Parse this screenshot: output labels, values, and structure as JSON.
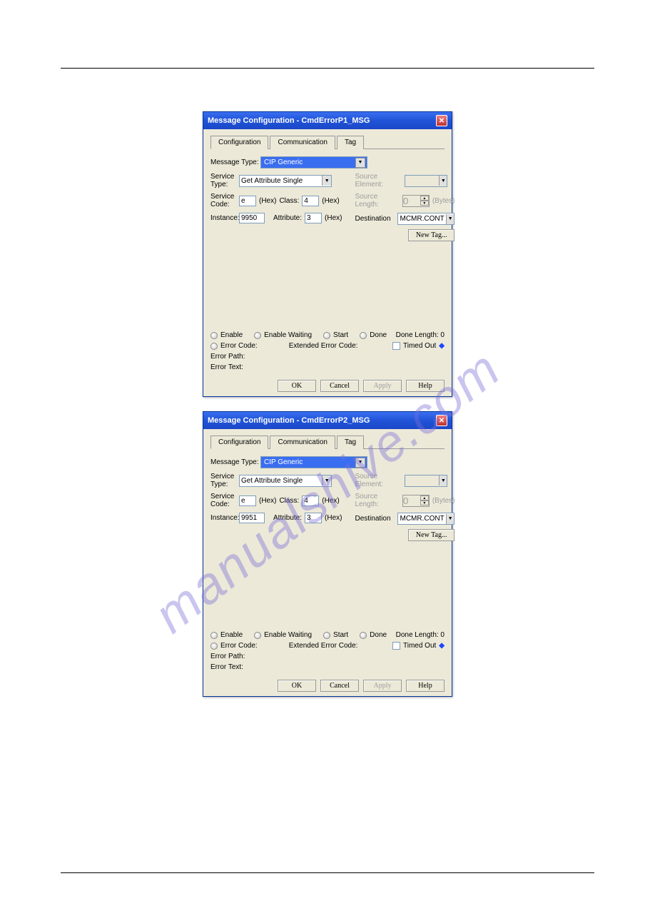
{
  "watermark": "manualshive.com",
  "dialogs": [
    {
      "title": "Message Configuration - CmdErrorP1_MSG",
      "tabs": [
        "Configuration",
        "Communication",
        "Tag"
      ],
      "active_tab": 0,
      "message_type_label": "Message Type:",
      "message_type": "CIP Generic",
      "service_type_label": "Service\nType:",
      "service_type": "Get Attribute Single",
      "service_code_label": "Service\nCode:",
      "service_code": "e",
      "instance_label": "Instance:",
      "instance": "9950",
      "class_label": "Class:",
      "class": "4",
      "attribute_label": "Attribute:",
      "attribute": "3",
      "hex": "(Hex)",
      "source_element_label": "Source Element:",
      "source_element": "",
      "source_length_label": "Source Length:",
      "source_length": "0",
      "bytes": "(Bytes)",
      "destination_label": "Destination",
      "destination": "MCMR.CONTROL.C",
      "new_tag": "New Tag...",
      "status": {
        "enable": "Enable",
        "enable_waiting": "Enable Waiting",
        "start": "Start",
        "done": "Done",
        "done_length": "Done Length: 0",
        "error_code": "Error Code:",
        "ext_error_code": "Extended Error Code:",
        "timed_out": "Timed Out",
        "error_path": "Error Path:",
        "error_text": "Error Text:"
      },
      "buttons": {
        "ok": "OK",
        "cancel": "Cancel",
        "apply": "Apply",
        "help": "Help"
      }
    },
    {
      "title": "Message Configuration - CmdErrorP2_MSG",
      "tabs": [
        "Configuration",
        "Communication",
        "Tag"
      ],
      "active_tab": 0,
      "message_type_label": "Message Type:",
      "message_type": "CIP Generic",
      "service_type_label": "Service\nType:",
      "service_type": "Get Attribute Single",
      "service_code_label": "Service\nCode:",
      "service_code": "e",
      "instance_label": "Instance:",
      "instance": "9951",
      "class_label": "Class:",
      "class": "4",
      "attribute_label": "Attribute:",
      "attribute": "3",
      "hex": "(Hex)",
      "source_element_label": "Source Element:",
      "source_element": "",
      "source_length_label": "Source Length:",
      "source_length": "0",
      "bytes": "(Bytes)",
      "destination_label": "Destination",
      "destination": "MCMR.CONTROL.C",
      "new_tag": "New Tag...",
      "status": {
        "enable": "Enable",
        "enable_waiting": "Enable Waiting",
        "start": "Start",
        "done": "Done",
        "done_length": "Done Length: 0",
        "error_code": "Error Code:",
        "ext_error_code": "Extended Error Code:",
        "timed_out": "Timed Out",
        "error_path": "Error Path:",
        "error_text": "Error Text:"
      },
      "buttons": {
        "ok": "OK",
        "cancel": "Cancel",
        "apply": "Apply",
        "help": "Help"
      }
    }
  ]
}
